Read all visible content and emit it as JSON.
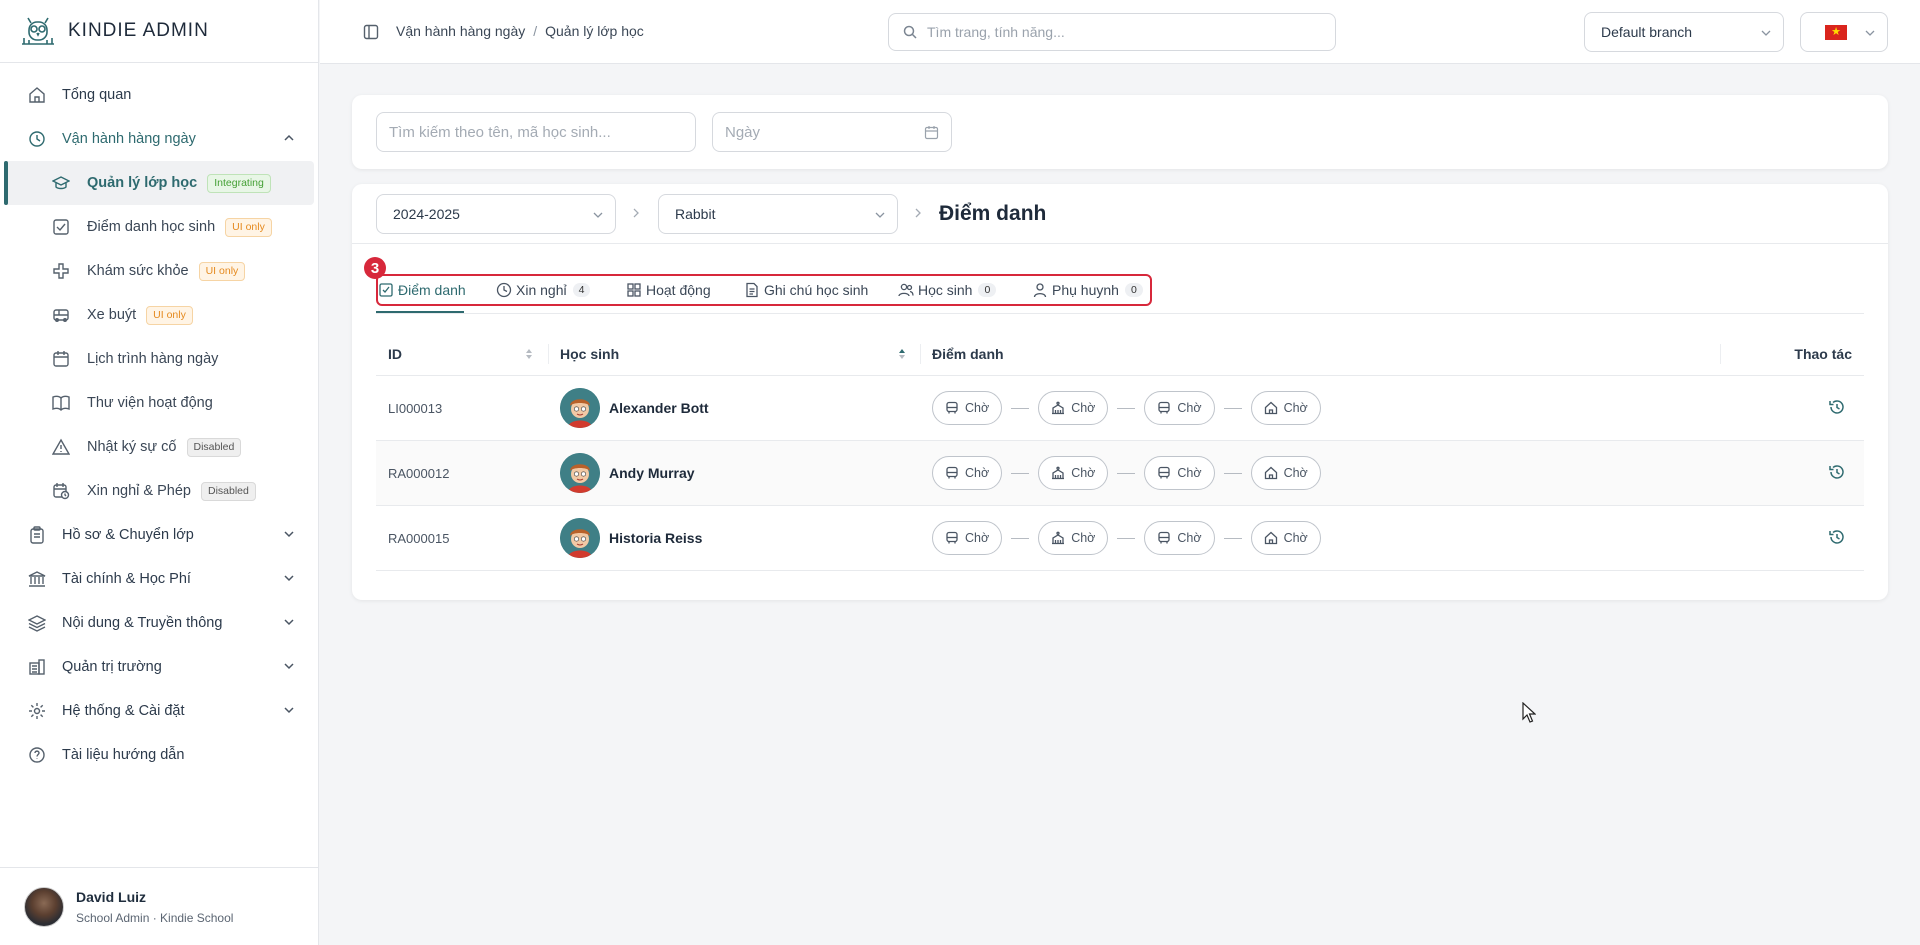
{
  "brand": {
    "name": "KINDIE ADMIN"
  },
  "sidebar": {
    "items": [
      {
        "label": "Tổng quan",
        "icon": "home-icon"
      },
      {
        "label": "Vận hành hàng ngày",
        "icon": "clock-icon"
      },
      {
        "label": "Hồ sơ & Chuyển lớp",
        "icon": "clipboard-icon"
      },
      {
        "label": "Tài chính & Học Phí",
        "icon": "bank-icon"
      },
      {
        "label": "Nội dung & Truyền thông",
        "icon": "layers-icon"
      },
      {
        "label": "Quản trị trường",
        "icon": "building-icon"
      },
      {
        "label": "Hệ thống & Cài đặt",
        "icon": "gear-icon"
      },
      {
        "label": "Tài liệu hướng dẫn",
        "icon": "help-circle-icon"
      }
    ],
    "sub_items": [
      {
        "label": "Quản lý lớp học",
        "badge": "Integrating",
        "icon": "graduation-cap-icon"
      },
      {
        "label": "Điểm danh học sinh",
        "badge": "UI only",
        "icon": "checkbox-icon"
      },
      {
        "label": "Khám sức khỏe",
        "badge": "UI only",
        "icon": "health-cross-icon"
      },
      {
        "label": "Xe buýt",
        "badge": "UI only",
        "icon": "bus-icon"
      },
      {
        "label": "Lịch trình hàng ngày",
        "badge": "",
        "icon": "calendar-icon"
      },
      {
        "label": "Thư viện hoạt động",
        "badge": "",
        "icon": "book-icon"
      },
      {
        "label": "Nhật ký sự cố",
        "badge": "Disabled",
        "icon": "warning-icon"
      },
      {
        "label": "Xin nghỉ & Phép",
        "badge": "Disabled",
        "icon": "calendar-clock-icon"
      }
    ]
  },
  "user": {
    "name": "David Luiz",
    "role": "School Admin · Kindie School"
  },
  "topbar": {
    "breadcrumb": [
      "Vận hành hàng ngày",
      "Quản lý lớp học"
    ],
    "breadcrumb_sep": "/",
    "search_placeholder": "Tìm trang, tính năng...",
    "branch": "Default branch",
    "language_flag": "vietnam-flag-icon"
  },
  "filters": {
    "search_placeholder": "Tìm kiếm theo tên, mã học sinh...",
    "date_placeholder": "Ngày"
  },
  "card": {
    "school_year": "2024-2025",
    "class_name": "Rabbit",
    "title": "Điểm danh"
  },
  "annotation_marker": "3",
  "tabs": [
    {
      "label": "Điểm danh",
      "count": "",
      "icon": "checkbox-icon"
    },
    {
      "label": "Xin nghỉ",
      "count": "4",
      "icon": "clock-icon"
    },
    {
      "label": "Hoạt động",
      "count": "",
      "icon": "grid-icon"
    },
    {
      "label": "Ghi chú học sinh",
      "count": "",
      "icon": "document-icon"
    },
    {
      "label": "Học sinh",
      "count": "0",
      "icon": "users-icon"
    },
    {
      "label": "Phụ huynh",
      "count": "0",
      "icon": "user-icon"
    }
  ],
  "table": {
    "headers": {
      "id": "ID",
      "student": "Học sinh",
      "attendance": "Điểm danh",
      "actions": "Thao tác"
    },
    "rows": [
      {
        "id": "LI000013",
        "name": "Alexander Bott",
        "statuses": [
          "Chờ",
          "Chờ",
          "Chờ",
          "Chờ"
        ]
      },
      {
        "id": "RA000012",
        "name": "Andy Murray",
        "statuses": [
          "Chờ",
          "Chờ",
          "Chờ",
          "Chờ"
        ]
      },
      {
        "id": "RA000015",
        "name": "Historia Reiss",
        "statuses": [
          "Chờ",
          "Chờ",
          "Chờ",
          "Chờ"
        ]
      }
    ]
  },
  "colors": {
    "accent": "#2e6a6f",
    "highlight": "#d7283b"
  }
}
